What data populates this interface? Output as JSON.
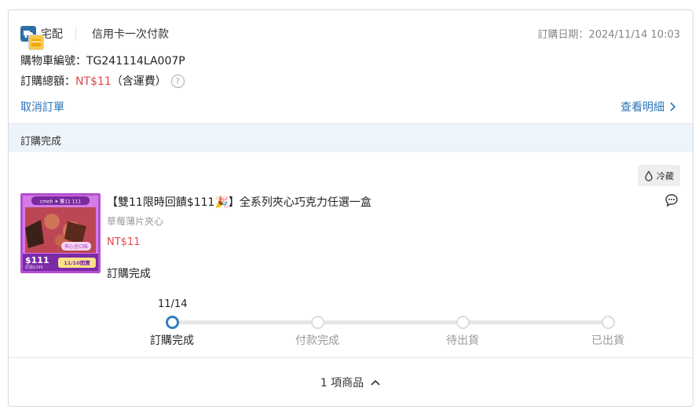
{
  "header": {
    "delivery_method": "宅配",
    "payment_method": "信用卡一次付款",
    "order_date_label": "訂購日期：",
    "order_date_value": "2024/11/14 10:03",
    "cart_number_label": "購物車編號：",
    "cart_number": "TG241114LA007P",
    "total_label": "訂購總額：",
    "total_amount": "NT$11",
    "total_note": "（含運費）",
    "help_icon": "?",
    "cancel_link": "取消訂單",
    "detail_link": "查看明細"
  },
  "status_bar": {
    "label": "訂購完成"
  },
  "product": {
    "tag": "冷藏",
    "name": "【雙11限時回饋$111🎉】全系列夾心巧克力任選一盒",
    "variant": "草莓薄片夾心",
    "price": "NT$11",
    "status": "訂購完成",
    "thumb": {
      "banner": "cmoh ✦ 雙11 111",
      "badge": "夾心全口味",
      "price": "$111",
      "orig": "原價$399",
      "date": "11/10開賣"
    }
  },
  "progress": {
    "date": "11/14",
    "current_step": 0,
    "steps": [
      {
        "label": "訂購完成"
      },
      {
        "label": "付款完成"
      },
      {
        "label": "待出貨"
      },
      {
        "label": "已出貨"
      }
    ]
  },
  "footer": {
    "label": "1 項商品"
  },
  "colors": {
    "accent": "#2f7fc1",
    "price_red": "#e5464d",
    "status_bg": "#eef4fb"
  },
  "icons": [
    "truck-icon",
    "credit-card-icon",
    "help-icon",
    "chevron-right-icon",
    "droplet-icon",
    "chat-icon",
    "chevron-up-icon"
  ]
}
